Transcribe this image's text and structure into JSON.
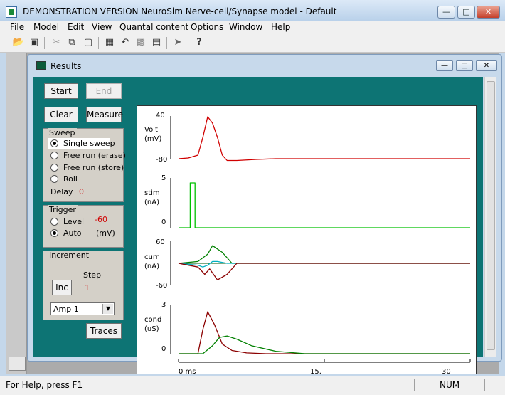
{
  "app": {
    "title": "DEMONSTRATION VERSION NeuroSim Nerve-cell/Synapse model - Default"
  },
  "menu": [
    "File",
    "Model",
    "Edit",
    "View",
    "Quantal content",
    "Options",
    "Window",
    "Help"
  ],
  "child": {
    "title": "Results"
  },
  "controls": {
    "start": "Start",
    "end": "End",
    "clear": "Clear",
    "measure": "Measure",
    "sweep": {
      "label": "Sweep",
      "options": [
        "Single sweep",
        "Free run (erase)",
        "Free run (store)",
        "Roll"
      ],
      "selected": "Single sweep",
      "delay_label": "Delay",
      "delay_value": "0"
    },
    "trigger": {
      "label": "Trigger",
      "level": "Level",
      "auto": "Auto",
      "selected": "Auto",
      "level_value": "-60",
      "unit": "(mV)"
    },
    "increment": {
      "label": "Increment",
      "step_label": "Step",
      "inc": "Inc",
      "step_value": "1",
      "amp_select": "Amp 1"
    },
    "traces": "Traces"
  },
  "plot": {
    "channels": [
      {
        "name": "Volt",
        "unit": "(mV)",
        "top": "40",
        "bottom": "-80"
      },
      {
        "name": "stim",
        "unit": "(nA)",
        "top": "5",
        "bottom": "0"
      },
      {
        "name": "curr",
        "unit": "(nA)",
        "top": "60",
        "bottom": "-60"
      },
      {
        "name": "cond",
        "unit": "(uS)",
        "top": "3",
        "bottom": "0"
      }
    ],
    "xticks": [
      "0 ms",
      "15.",
      "30"
    ]
  },
  "chart_data": {
    "type": "line",
    "x_range_ms": [
      0,
      30
    ],
    "series": [
      {
        "channel": "Volt",
        "color": "#d00000",
        "x": [
          0,
          1,
          2,
          2.5,
          3,
          3.5,
          4,
          4.5,
          5,
          6,
          8,
          10,
          12,
          15,
          20,
          25,
          30
        ],
        "y": [
          -80,
          -78,
          -70,
          -20,
          38,
          20,
          -20,
          -70,
          -85,
          -85,
          -82,
          -80,
          -80,
          -80,
          -80,
          -80,
          -80
        ]
      },
      {
        "channel": "stim",
        "color": "#00c000",
        "x": [
          0,
          1.2,
          1.2,
          1.7,
          1.7,
          30
        ],
        "y": [
          0,
          0,
          4.5,
          4.5,
          0,
          0
        ]
      },
      {
        "channel": "curr",
        "color": "#008000",
        "x": [
          0,
          2,
          3,
          3.5,
          4.5,
          5.5,
          30
        ],
        "y": [
          0,
          5,
          25,
          48,
          30,
          0,
          0
        ]
      },
      {
        "channel": "curr",
        "color": "#00b0c0",
        "x": [
          0,
          2,
          2.5,
          3,
          3.5,
          4,
          5,
          30
        ],
        "y": [
          0,
          -5,
          -10,
          -5,
          5,
          5,
          0,
          0
        ]
      },
      {
        "channel": "curr",
        "color": "#8b0000",
        "x": [
          0,
          2,
          2.7,
          3.2,
          4,
          5,
          6,
          30
        ],
        "y": [
          0,
          -10,
          -30,
          -15,
          -45,
          -30,
          0,
          0
        ]
      },
      {
        "channel": "cond",
        "color": "#8b0000",
        "x": [
          0,
          2,
          2.5,
          3,
          3.7,
          4.5,
          5.5,
          7,
          9,
          30
        ],
        "y": [
          0,
          0,
          1.5,
          2.6,
          1.8,
          0.6,
          0.2,
          0.05,
          0,
          0
        ]
      },
      {
        "channel": "cond",
        "color": "#008000",
        "x": [
          0,
          2.5,
          3.5,
          4.2,
          5,
          6,
          7.5,
          10,
          13,
          30
        ],
        "y": [
          0,
          0,
          0.5,
          1.0,
          1.1,
          0.9,
          0.5,
          0.15,
          0,
          0
        ]
      }
    ]
  },
  "status": {
    "text": "For Help, press F1",
    "num": "NUM"
  }
}
